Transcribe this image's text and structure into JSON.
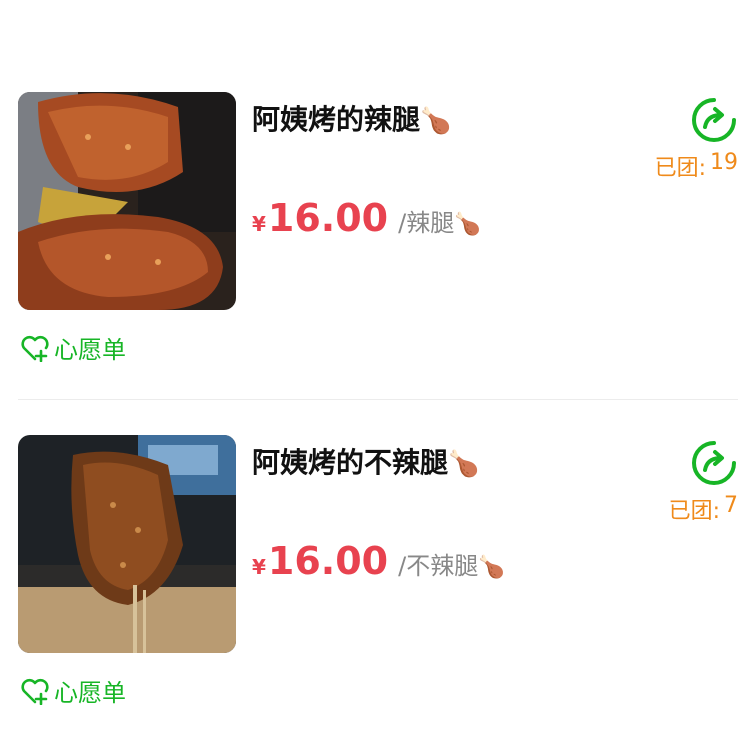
{
  "header": {
    "fragment": "· · · ·"
  },
  "items": [
    {
      "title": "阿姨烤的辣腿",
      "title_emoji": "🍗",
      "currency": "¥",
      "price": "16.00",
      "unit": "/辣腿",
      "unit_emoji": "🍗",
      "grouped_label": "已团:",
      "grouped_count": "19",
      "wishlist_label": "心愿单"
    },
    {
      "title": "阿姨烤的不辣腿",
      "title_emoji": "🍗",
      "currency": "¥",
      "price": "16.00",
      "unit": "/不辣腿",
      "unit_emoji": "🍗",
      "grouped_label": "已团:",
      "grouped_count": "7",
      "wishlist_label": "心愿单"
    }
  ],
  "colors": {
    "price": "#e8424f",
    "grouped": "#ef8a1a",
    "accent_green": "#17b526"
  },
  "icons": {
    "share": "share-arrow-icon",
    "wishlist": "heart-plus-icon"
  }
}
